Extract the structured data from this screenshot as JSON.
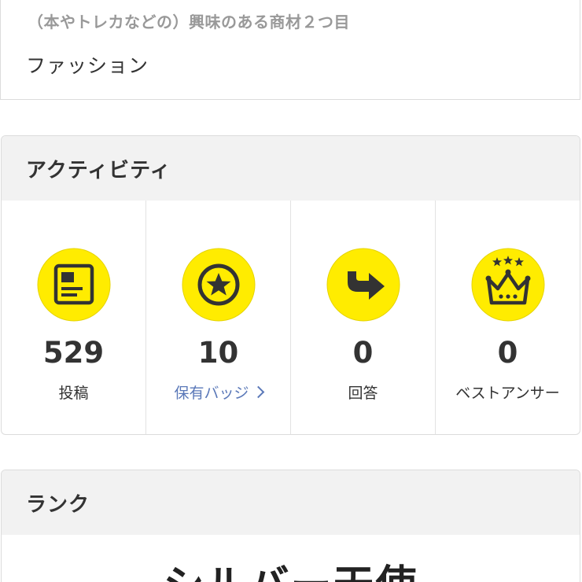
{
  "interest": {
    "label": "（本やトレカなどの）興味のある商材２つ目",
    "value": "ファッション"
  },
  "activity": {
    "title": "アクティビティ",
    "stats": [
      {
        "icon": "document-icon",
        "value": "529",
        "label": "投稿"
      },
      {
        "icon": "star-badge-icon",
        "value": "10",
        "label": "保有バッジ"
      },
      {
        "icon": "reply-arrow-icon",
        "value": "0",
        "label": "回答"
      },
      {
        "icon": "crown-icon",
        "value": "0",
        "label": "ベストアンサー"
      }
    ]
  },
  "rank": {
    "title": "ランク",
    "value": "シルバー天使"
  },
  "colors": {
    "icon_bg": "#ffec00",
    "icon_fg": "#333333",
    "link": "#5a78b8",
    "header_bg": "#f2f2f2"
  }
}
